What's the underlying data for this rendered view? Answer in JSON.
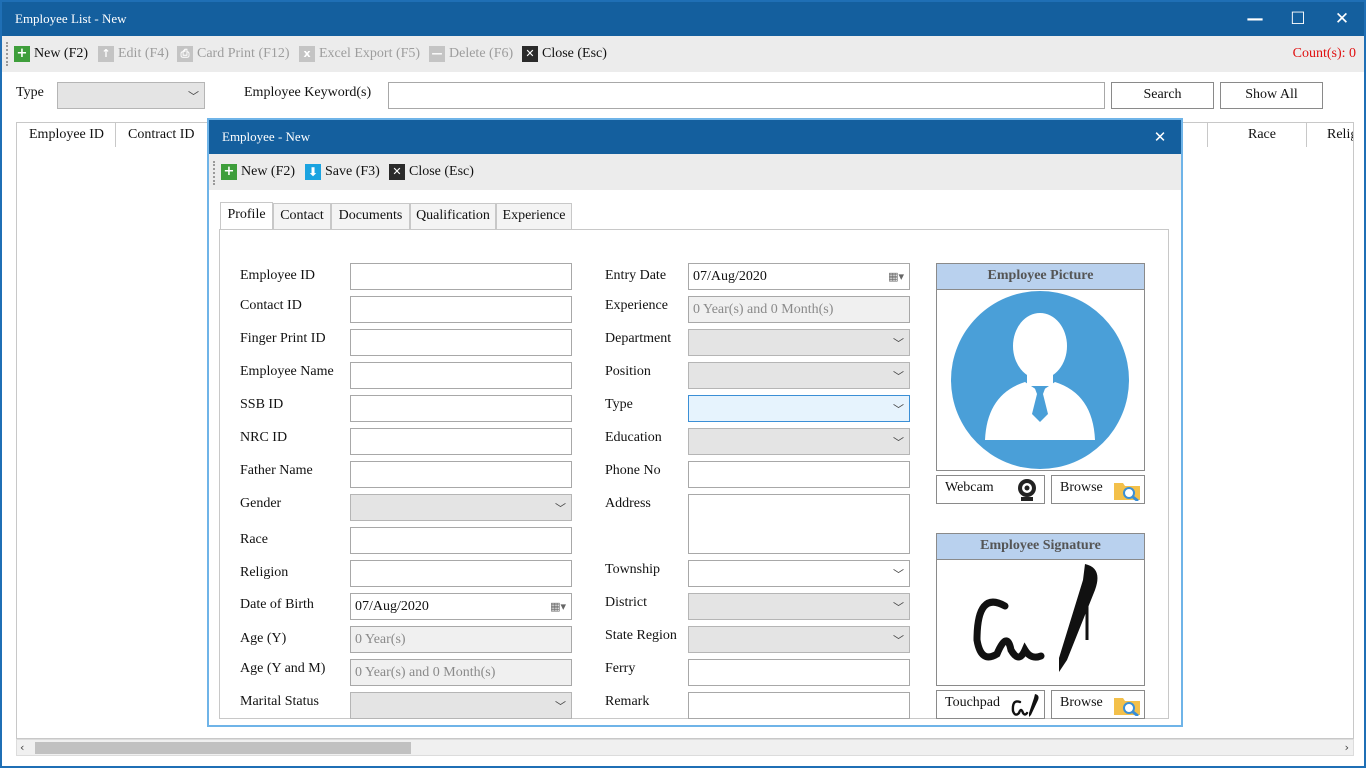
{
  "window": {
    "title": "Employee List - New"
  },
  "toolbar": {
    "new": "New (F2)",
    "edit": "Edit (F4)",
    "card_print": "Card Print (F12)",
    "excel_export": "Excel Export (F5)",
    "delete": "Delete (F6)",
    "close": "Close (Esc)",
    "count": "Count(s): 0"
  },
  "filter": {
    "type_label": "Type",
    "type_value": "",
    "keyword_label": "Employee Keyword(s)",
    "keyword_value": "",
    "search": "Search",
    "show_all": "Show All"
  },
  "grid": {
    "columns": [
      "Employee ID",
      "Contract ID",
      "Race",
      "Relig"
    ]
  },
  "dialog": {
    "title": "Employee - New",
    "toolbar": {
      "new": "New (F2)",
      "save": "Save (F3)",
      "close": "Close (Esc)"
    },
    "tabs": [
      "Profile",
      "Contact",
      "Documents",
      "Qualification",
      "Experience"
    ],
    "left_fields": {
      "employee_id": {
        "label": "Employee ID",
        "value": ""
      },
      "contact_id": {
        "label": "Contact ID",
        "value": ""
      },
      "finger_print_id": {
        "label": "Finger Print ID",
        "value": ""
      },
      "employee_name": {
        "label": "Employee Name",
        "value": ""
      },
      "ssb_id": {
        "label": "SSB ID",
        "value": ""
      },
      "nrc_id": {
        "label": "NRC ID",
        "value": ""
      },
      "father_name": {
        "label": "Father Name",
        "value": ""
      },
      "gender": {
        "label": "Gender",
        "value": ""
      },
      "race": {
        "label": "Race",
        "value": ""
      },
      "religion": {
        "label": "Religion",
        "value": ""
      },
      "date_of_birth": {
        "label": "Date of Birth",
        "value": "07/Aug/2020"
      },
      "age_y": {
        "label": "Age (Y)",
        "value": "0 Year(s)"
      },
      "age_ym": {
        "label": "Age (Y and M)",
        "value": "0 Year(s) and 0 Month(s)"
      },
      "marital_status": {
        "label": "Marital Status",
        "value": ""
      }
    },
    "right_fields": {
      "entry_date": {
        "label": "Entry Date",
        "value": "07/Aug/2020"
      },
      "experience": {
        "label": "Experience",
        "value": "0 Year(s) and 0 Month(s)"
      },
      "department": {
        "label": "Department",
        "value": ""
      },
      "position": {
        "label": "Position",
        "value": ""
      },
      "type": {
        "label": "Type",
        "value": ""
      },
      "education": {
        "label": "Education",
        "value": ""
      },
      "phone_no": {
        "label": "Phone No",
        "value": ""
      },
      "address": {
        "label": "Address",
        "value": ""
      },
      "township": {
        "label": "Township",
        "value": ""
      },
      "district": {
        "label": "District",
        "value": ""
      },
      "state_region": {
        "label": "State Region",
        "value": ""
      },
      "ferry": {
        "label": "Ferry",
        "value": ""
      },
      "remark": {
        "label": "Remark",
        "value": ""
      }
    },
    "picture": {
      "title": "Employee Picture",
      "webcam": "Webcam",
      "browse": "Browse"
    },
    "signature": {
      "title": "Employee Signature",
      "touchpad": "Touchpad",
      "browse": "Browse"
    }
  },
  "colors": {
    "title_bar": "#145f9e",
    "accent_border": "#6fb4e8",
    "count_text": "#e01010",
    "picture_header": "#b9d1ee",
    "avatar": "#4a9fd8"
  },
  "icons": [
    "plus-icon",
    "edit-icon",
    "printer-icon",
    "excel-icon",
    "delete-icon",
    "close-icon",
    "save-icon",
    "calendar-icon",
    "chevron-down-icon",
    "webcam-icon",
    "folder-search-icon",
    "signature-pen-icon",
    "user-avatar-icon"
  ]
}
